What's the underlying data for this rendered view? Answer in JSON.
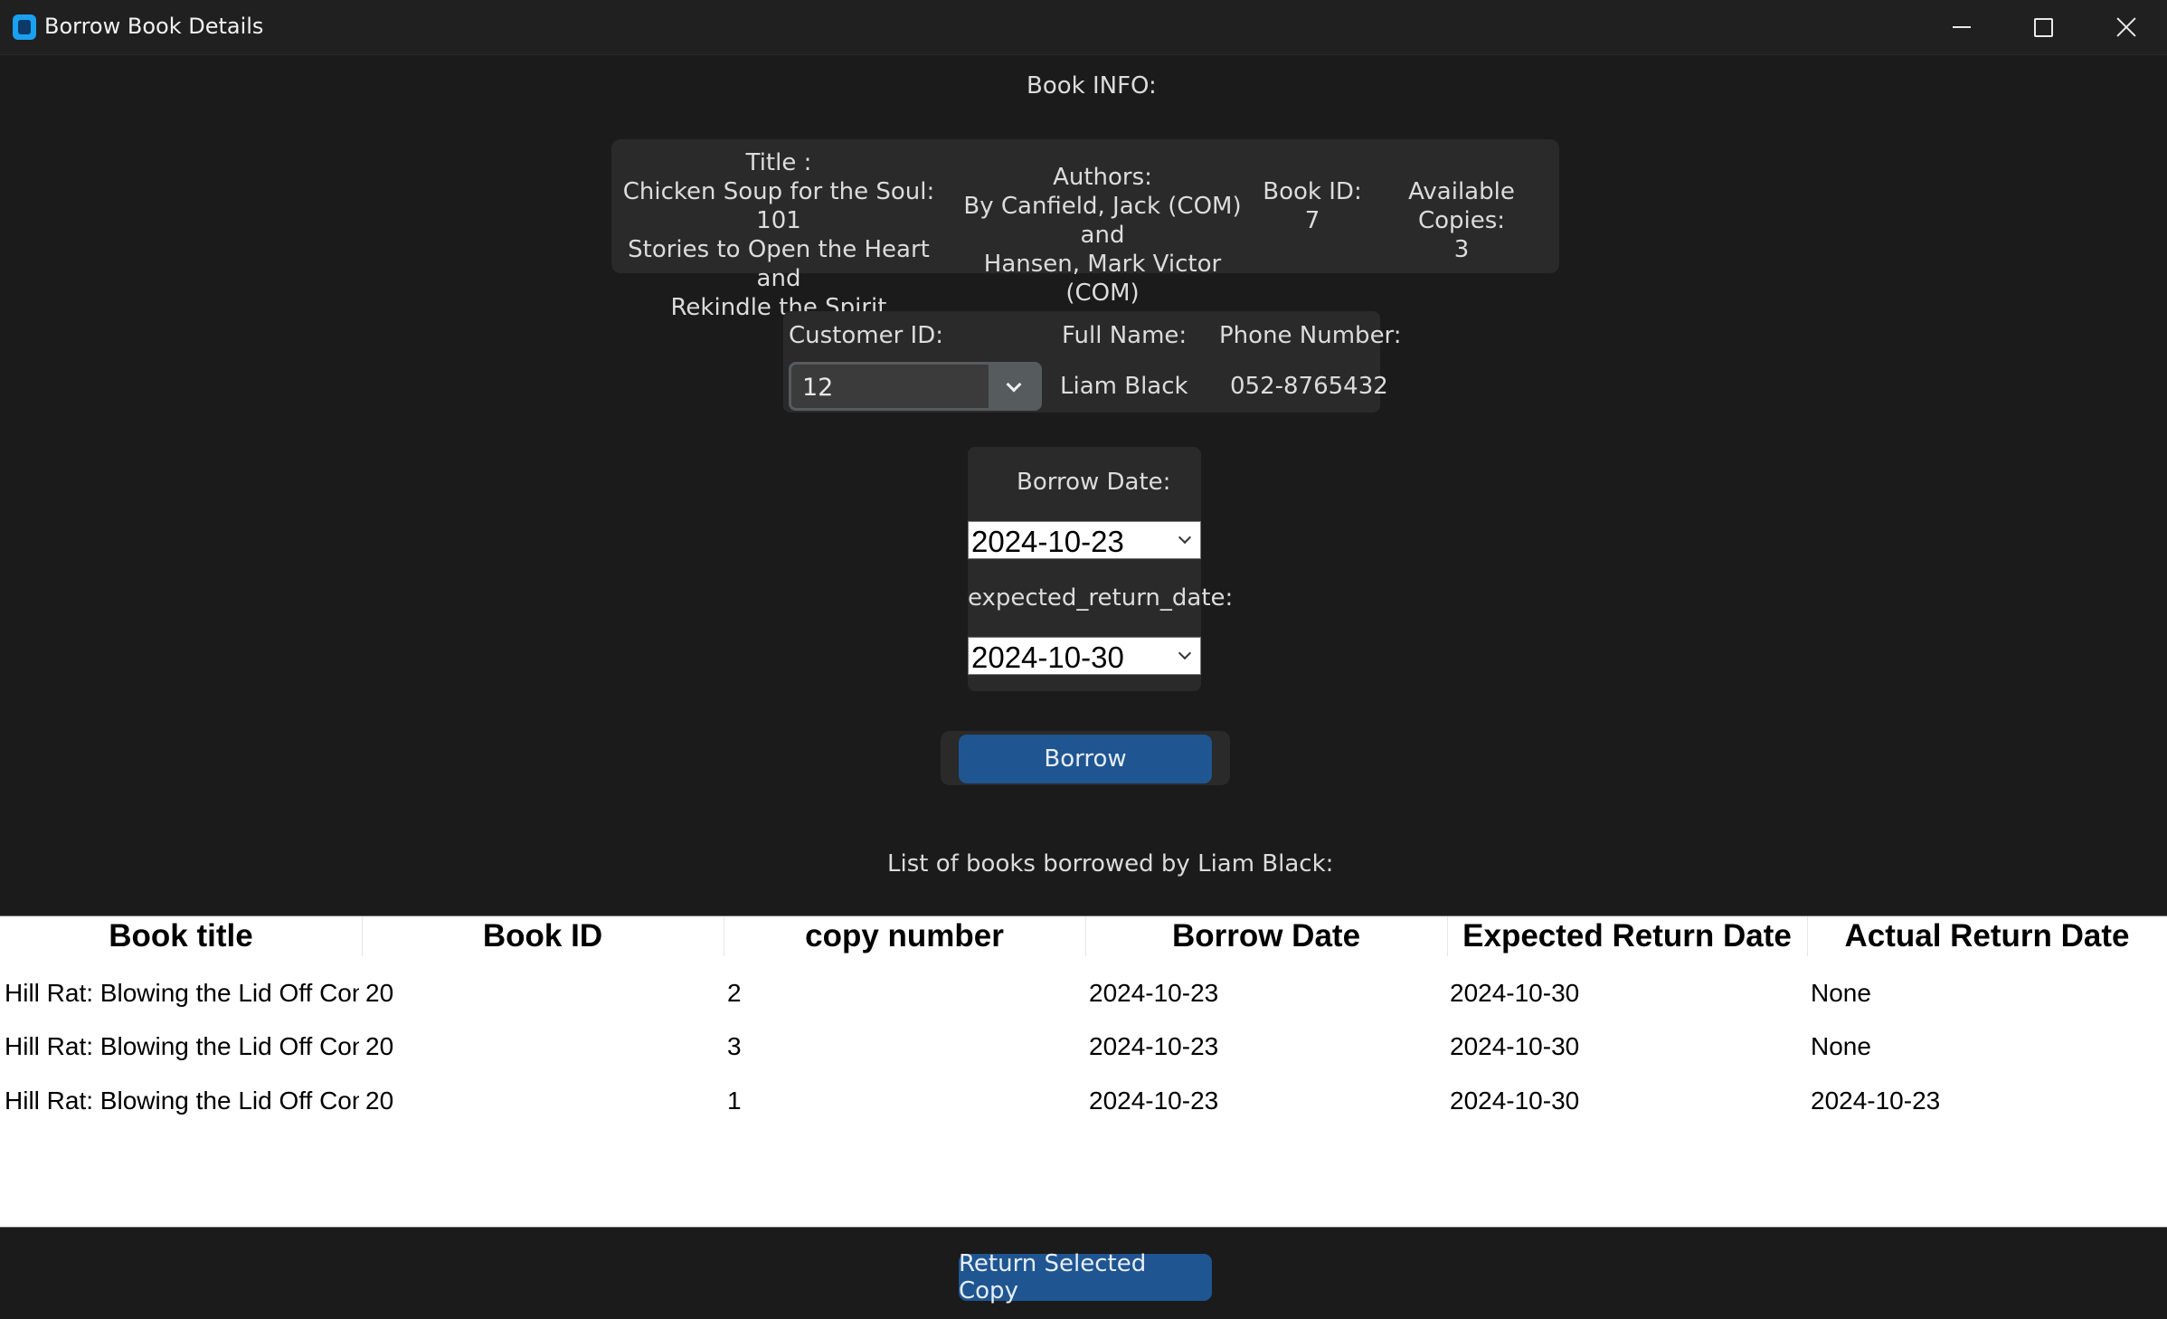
{
  "window": {
    "title": "Borrow Book Details"
  },
  "book_info": {
    "heading": "Book INFO:",
    "title_label": "Title :",
    "title_lines": [
      "Chicken Soup for the Soul: 101",
      "Stories to Open the Heart and",
      "Rekindle the Spirit"
    ],
    "authors_label": "Authors:",
    "authors_lines": [
      "By Canfield, Jack (COM) and",
      "Hansen, Mark Victor (COM)"
    ],
    "book_id_label": "Book ID:",
    "book_id": "7",
    "copies_label": "Available Copies:",
    "copies": "3"
  },
  "customer": {
    "id_label": "Customer ID:",
    "id_value": "12",
    "name_label": "Full Name:",
    "name_value": "Liam Black",
    "phone_label": "Phone Number:",
    "phone_value": "052-8765432"
  },
  "dates": {
    "borrow_label": "Borrow Date:",
    "borrow_value": "2024-10-23",
    "expected_label": "expected_return_date:",
    "expected_value": "2024-10-30"
  },
  "borrow_button": "Borrow",
  "list_heading": "List of books borrowed by Liam Black:",
  "table": {
    "columns": [
      "Book title",
      "Book ID",
      "copy number",
      "Borrow Date",
      "Expected Return Date",
      "Actual Return Date"
    ],
    "rows": [
      [
        "Hill Rat: Blowing the Lid Off Con",
        "20",
        "2",
        "2024-10-23",
        "2024-10-30",
        "None"
      ],
      [
        "Hill Rat: Blowing the Lid Off Con",
        "20",
        "3",
        "2024-10-23",
        "2024-10-30",
        "None"
      ],
      [
        "Hill Rat: Blowing the Lid Off Con",
        "20",
        "1",
        "2024-10-23",
        "2024-10-30",
        "2024-10-23"
      ]
    ]
  },
  "return_button": "Return Selected Copy",
  "colors": {
    "background": "#1b1b1b",
    "panel": "#2a2a2a",
    "button": "#1f5590",
    "app_icon": "#1aa0f0"
  },
  "icons": [
    "app-icon",
    "minimize-icon",
    "maximize-icon",
    "close-icon",
    "chevron-down-icon"
  ]
}
